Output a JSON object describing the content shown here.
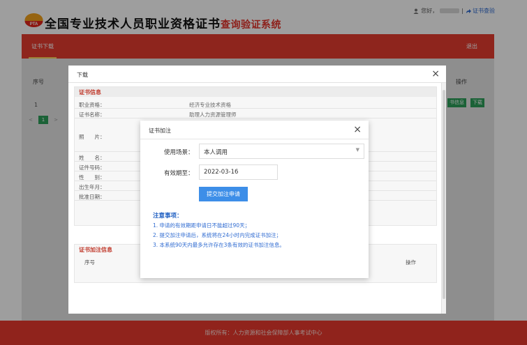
{
  "header": {
    "logo_text": "PTA",
    "title_main": "全国专业技术人员职业资格证书",
    "title_sub": "查询验证系统",
    "greeting": "您好，",
    "separator": "|",
    "verify_link": "证书查验"
  },
  "nav": {
    "tab": "证书下载",
    "logout": "退出"
  },
  "background_table": {
    "columns": [
      "序号",
      "操作"
    ],
    "row_index": "1",
    "buttons": [
      "书信息",
      "下载"
    ],
    "pager": {
      "prev": "<",
      "current": "1",
      "next": ">"
    }
  },
  "download_dialog": {
    "title": "下载",
    "close": "×",
    "section1": "证书信息",
    "fields": [
      {
        "label": "职业资格：",
        "value": "经济专业技术资格"
      },
      {
        "label": "证书名称：",
        "value": "助理人力资源管理师"
      },
      {
        "label": "照　　片：",
        "value": ""
      },
      {
        "label": "姓　　名：",
        "value": ""
      },
      {
        "label": "证件号码：",
        "value": ""
      },
      {
        "label": "性　　别：",
        "value": ""
      },
      {
        "label": "出生年月：",
        "value": ""
      },
      {
        "label": "批准日期：",
        "value": ""
      }
    ],
    "section2": "证书加注信息",
    "section2_columns": [
      "序号",
      "操作"
    ]
  },
  "endorse_dialog": {
    "title": "证书加注",
    "close": "×",
    "scene_label": "使用场景：",
    "scene_value": "本人调用",
    "expiry_label": "有效期至：",
    "expiry_value": "2022-03-16",
    "submit": "提交加注申请",
    "notes_title": "注意事项：",
    "notes": [
      "1. 申请的有效期距申请日不能超过90天；",
      "2. 提交加注申请后，系统将在24小时内完成证书加注；",
      "3. 本系统90天内最多允许存在3条有效的证书加注信息。"
    ]
  },
  "footer": {
    "text": "版权所有：人力资源和社会保障部人事考试中心"
  },
  "colors": {
    "brand_red": "#e53d30",
    "primary_blue": "#3d8ee8",
    "note_blue": "#2f6bd1",
    "download_green": "#2d9e5a"
  }
}
